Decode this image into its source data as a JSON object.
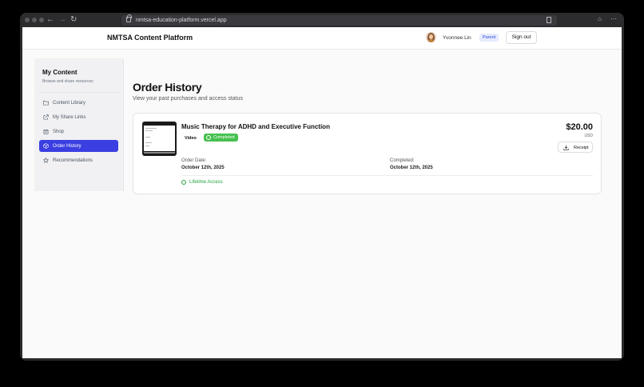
{
  "browser": {
    "url": "nmtsa-education-platform.vercel.app"
  },
  "header": {
    "brand": "NMTSA Content Platform",
    "user_name": "Yvonnee Lin",
    "role": "Parent",
    "signout_label": "Sign out"
  },
  "sidebar": {
    "title": "My Content",
    "subtitle": "Browse and share resources",
    "items": [
      {
        "label": "Content Library",
        "icon": "folder-icon",
        "active": false
      },
      {
        "label": "My Share Links",
        "icon": "external-link-icon",
        "active": false
      },
      {
        "label": "Shop",
        "icon": "shopping-bag-icon",
        "active": false
      },
      {
        "label": "Order History",
        "icon": "package-icon",
        "active": true
      },
      {
        "label": "Recommendations",
        "icon": "star-icon",
        "active": false
      }
    ]
  },
  "main": {
    "title": "Order History",
    "subtitle": "View your past purchases and access status"
  },
  "order": {
    "title": "Music Therapy for ADHD and Executive Function",
    "type": "Video",
    "status": "Completed",
    "price": "$20.00",
    "currency": "USD",
    "receipt_label": "Receipt",
    "order_date_label": "Order Date:",
    "order_date": "October 12th, 2025",
    "completed_label": "Completed:",
    "completed_date": "October 12th, 2025",
    "access": "Lifetime Access"
  },
  "colors": {
    "accent": "#3b3ee0",
    "success": "#46c04f",
    "role_badge_bg": "#e6ebff"
  }
}
